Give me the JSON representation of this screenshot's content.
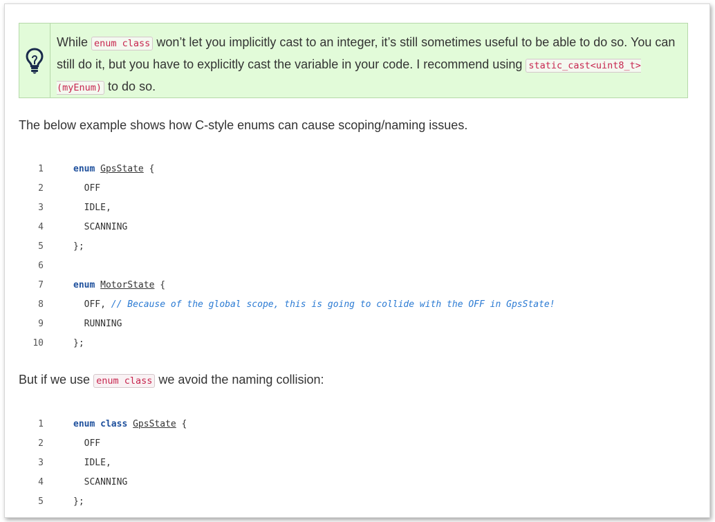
{
  "tip": {
    "icon": "lightbulb-icon",
    "text_1": "While",
    "code_1": "enum class",
    "text_2": " won’t let you implicitly cast to an integer, it’s still sometimes useful to be able to do so. You can still do it, but you have to explicitly cast the variable in your code. I recommend using ",
    "code_2": "static_cast<uint8_t>(myEnum)",
    "text_3": " to do so."
  },
  "paragraph_1": "The below example shows how C-style enums can cause scoping/naming issues.",
  "code_block_1": {
    "lines": [
      {
        "n": "1",
        "kw": "enum",
        "kw2": "",
        "type": "GpsState",
        "rest": " {",
        "indent": "",
        "plain": "",
        "comment": ""
      },
      {
        "n": "2",
        "plain": "  OFF"
      },
      {
        "n": "3",
        "plain": "  IDLE,"
      },
      {
        "n": "4",
        "plain": "  SCANNING"
      },
      {
        "n": "5",
        "plain": "};"
      },
      {
        "n": "6",
        "plain": ""
      },
      {
        "n": "7",
        "kw": "enum",
        "kw2": "",
        "type": "MotorState",
        "rest": " {"
      },
      {
        "n": "8",
        "plain": "  OFF, ",
        "comment": "// Because of the global scope, this is going to collide with the OFF in GpsState!"
      },
      {
        "n": "9",
        "plain": "  RUNNING"
      },
      {
        "n": "10",
        "plain": "};"
      }
    ]
  },
  "paragraph_2": {
    "text_1": "But if we use ",
    "code": "enum class",
    "text_2": " we avoid the naming collision:"
  },
  "code_block_2": {
    "lines": [
      {
        "n": "1",
        "kw": "enum",
        "kw2": "class",
        "type": "GpsState",
        "rest": " {"
      },
      {
        "n": "2",
        "plain": "  OFF"
      },
      {
        "n": "3",
        "plain": "  IDLE,"
      },
      {
        "n": "4",
        "plain": "  SCANNING"
      },
      {
        "n": "5",
        "plain": "};"
      }
    ]
  }
}
